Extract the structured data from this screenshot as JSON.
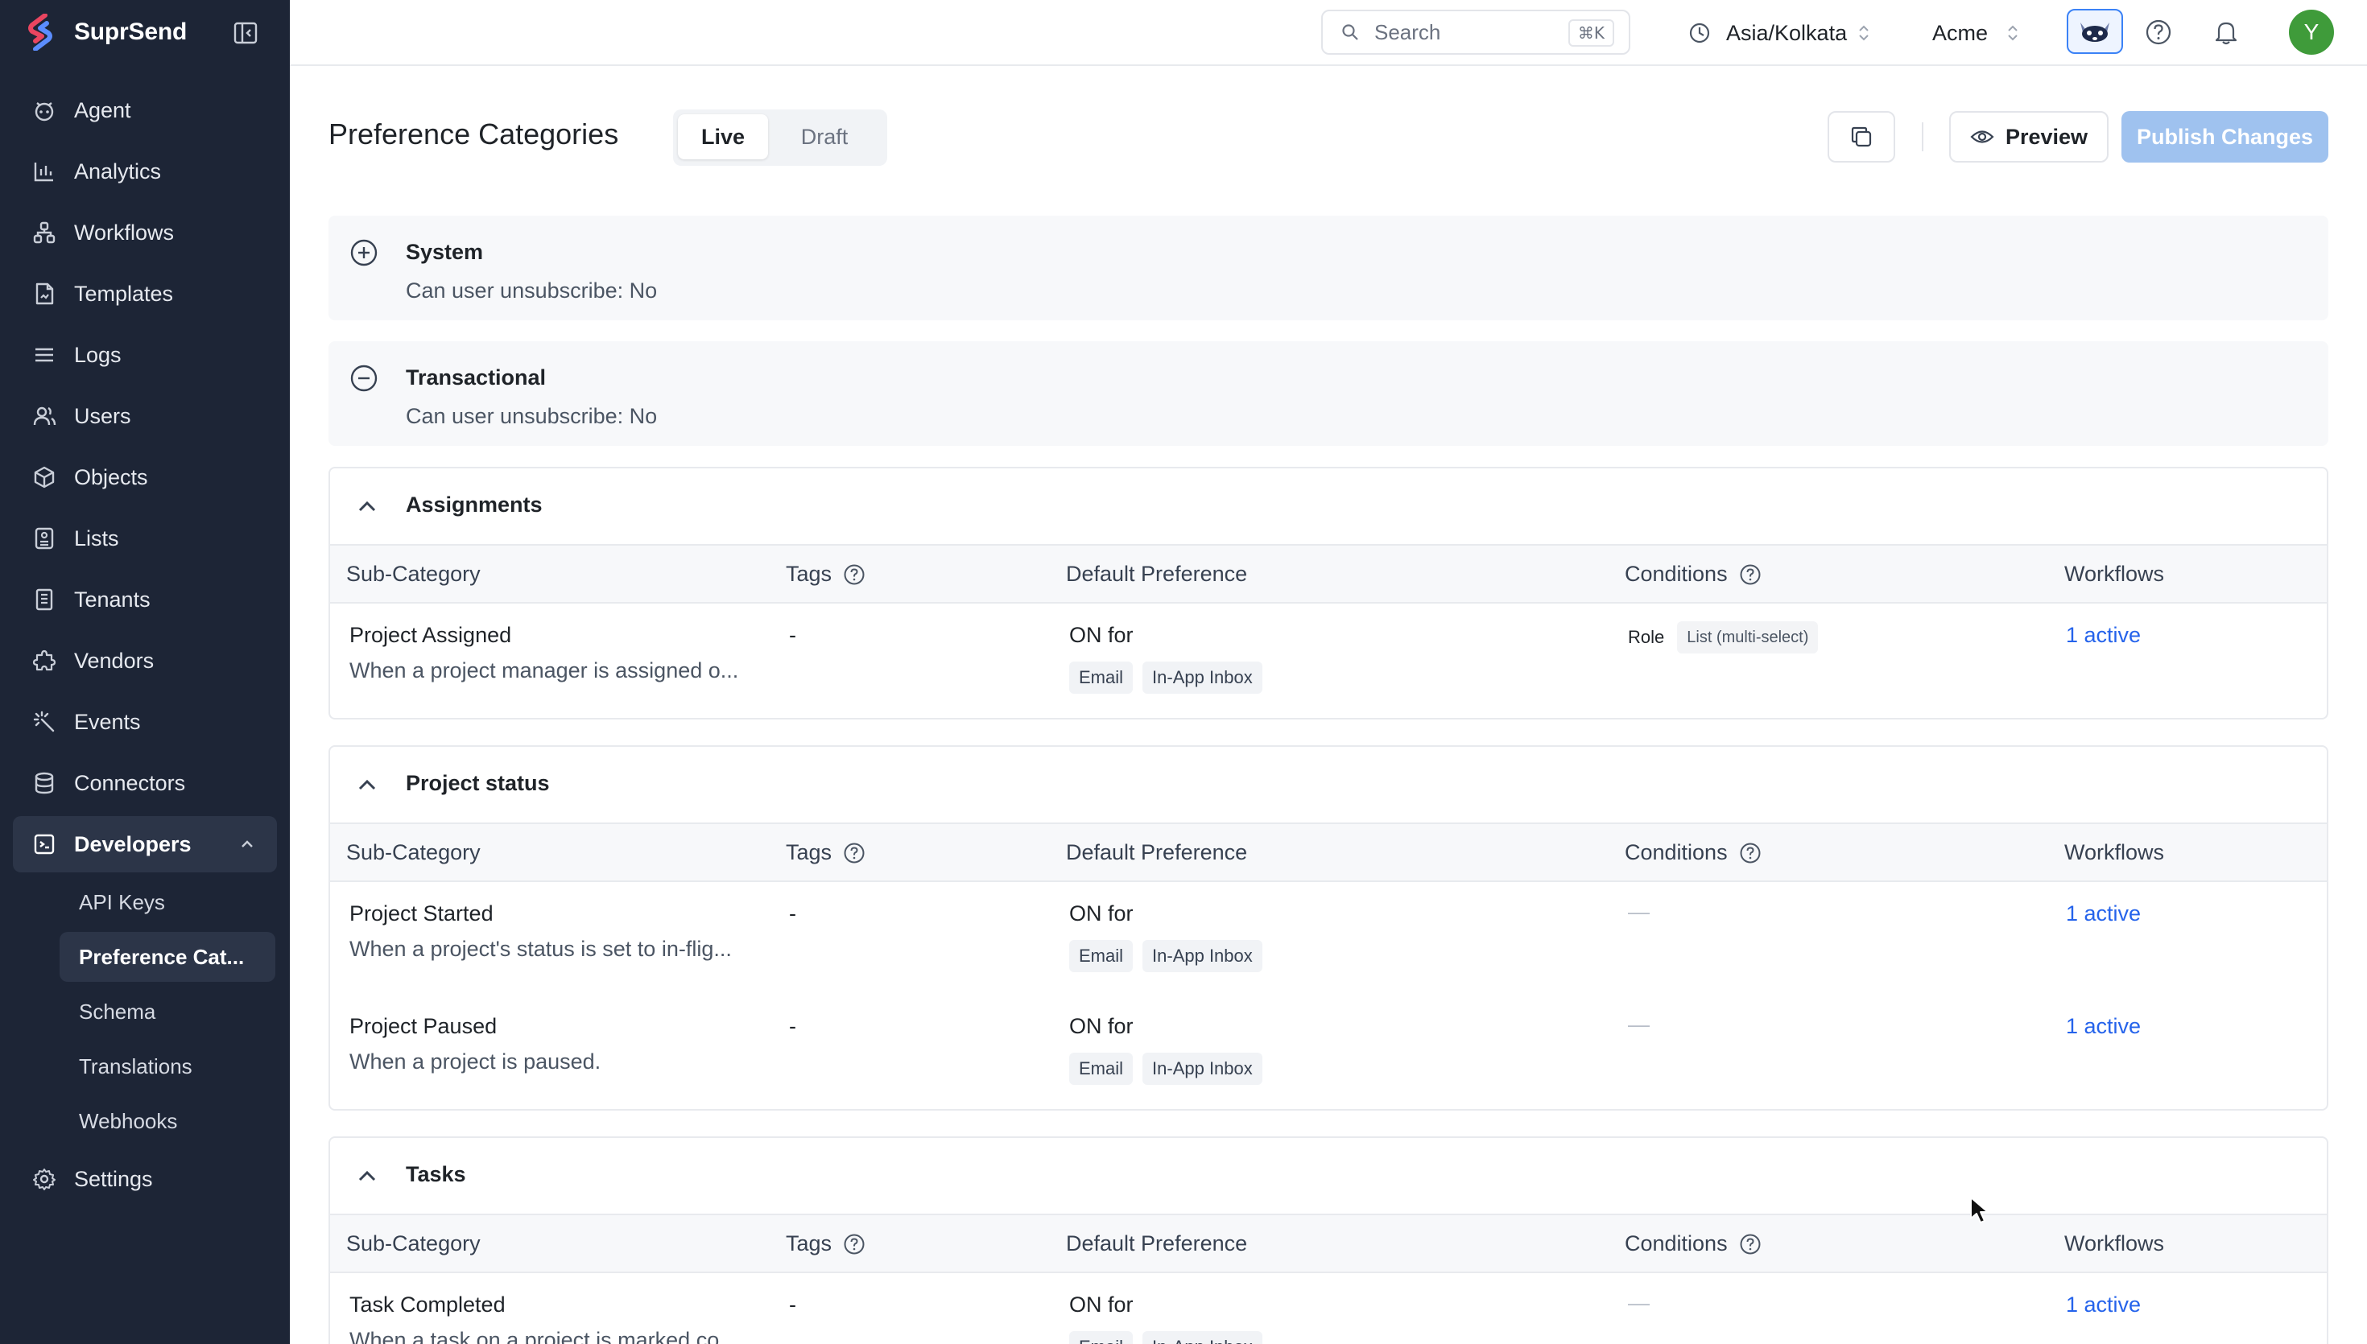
{
  "brand": {
    "name": "SuprSend"
  },
  "sidebar": {
    "items": [
      {
        "label": "Agent",
        "icon": "agent-icon"
      },
      {
        "label": "Analytics",
        "icon": "bar-chart-icon"
      },
      {
        "label": "Workflows",
        "icon": "workflow-icon"
      },
      {
        "label": "Templates",
        "icon": "template-icon"
      },
      {
        "label": "Logs",
        "icon": "list-lines-icon"
      },
      {
        "label": "Users",
        "icon": "users-icon"
      },
      {
        "label": "Objects",
        "icon": "cube-icon"
      },
      {
        "label": "Lists",
        "icon": "list-icon"
      },
      {
        "label": "Tenants",
        "icon": "building-icon"
      },
      {
        "label": "Vendors",
        "icon": "puzzle-icon"
      },
      {
        "label": "Events",
        "icon": "sparkle-icon"
      },
      {
        "label": "Connectors",
        "icon": "database-icon"
      },
      {
        "label": "Developers",
        "icon": "code-icon"
      }
    ],
    "developer_sub": [
      "API Keys",
      "Preference Cat...",
      "Schema",
      "Translations",
      "Webhooks"
    ],
    "settings": {
      "label": "Settings",
      "icon": "gear-icon"
    }
  },
  "topbar": {
    "search_placeholder": "Search",
    "search_shortcut": "⌘K",
    "timezone": "Asia/Kolkata",
    "org": "Acme",
    "avatar_initial": "Y"
  },
  "header": {
    "title": "Preference Categories",
    "tabs": [
      "Live",
      "Draft"
    ],
    "active_tab": "Live",
    "preview_label": "Preview",
    "publish_label": "Publish Changes"
  },
  "columns": [
    "Sub-Category",
    "Tags",
    "Default Preference",
    "Conditions",
    "Workflows"
  ],
  "simple_categories": [
    {
      "name": "System",
      "desc": "Can user unsubscribe: No",
      "state": "collapsed"
    },
    {
      "name": "Transactional",
      "desc": "Can user unsubscribe: No",
      "state": "expanded"
    }
  ],
  "categories": [
    {
      "name": "Assignments",
      "rows": [
        {
          "title": "Project Assigned",
          "sub": "When a project manager is assigned o...",
          "tags": "-",
          "pref": "ON for",
          "channels": [
            "Email",
            "In-App Inbox"
          ],
          "cond_key": "Role",
          "cond_val": "List (multi-select)",
          "workflows": "1 active"
        }
      ]
    },
    {
      "name": "Project status",
      "rows": [
        {
          "title": "Project Started",
          "sub": "When a project's status is set to in-flig...",
          "tags": "-",
          "pref": "ON for",
          "channels": [
            "Email",
            "In-App Inbox"
          ],
          "cond_none": "—",
          "workflows": "1 active"
        },
        {
          "title": "Project Paused",
          "sub": "When a project is paused.",
          "tags": "-",
          "pref": "ON for",
          "channels": [
            "Email",
            "In-App Inbox"
          ],
          "cond_none": "—",
          "workflows": "1 active"
        }
      ]
    },
    {
      "name": "Tasks",
      "rows": [
        {
          "title": "Task Completed",
          "sub": "When a task on a project is marked co...",
          "tags": "-",
          "pref": "ON for",
          "channels": [
            "Email",
            "In-App Inbox"
          ],
          "cond_none": "—",
          "workflows": "1 active"
        }
      ]
    }
  ],
  "colors": {
    "sidebar_bg": "#1d2536",
    "accent": "#2563eb",
    "publish_disabled": "#9fc2ef",
    "avatar": "#3f9b3a"
  }
}
